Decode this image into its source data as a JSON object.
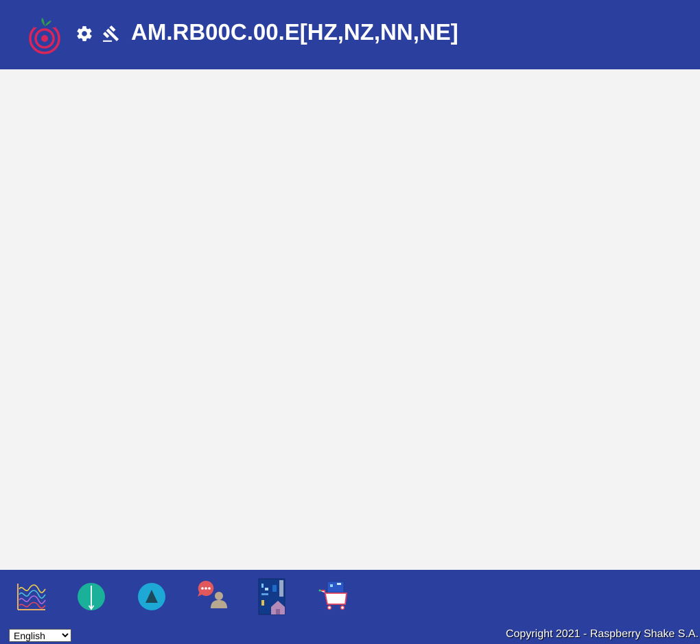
{
  "header": {
    "title": "AM.RB00C.00.E[HZ,NZ,NN,NE]",
    "logo_icon": "raspberry-shake-logo-icon",
    "settings_icon": "gear-icon",
    "gavel_icon": "gavel-icon"
  },
  "footer": {
    "dock": [
      {
        "name": "helicorder-waves-icon"
      },
      {
        "name": "down-arrow-circle-icon"
      },
      {
        "name": "triangle-circle-icon"
      },
      {
        "name": "chat-user-icon"
      },
      {
        "name": "board-home-icon"
      },
      {
        "name": "shop-cart-icon"
      }
    ],
    "language": {
      "selected": "English",
      "options": [
        "English"
      ]
    },
    "copyright": "Copyright 2021 - Raspberry Shake S.A."
  },
  "colors": {
    "brand_blue": "#2b3f9e",
    "background": "#f3f3f3",
    "logo_red": "#d7265a",
    "leaf_green": "#2e9e4c"
  }
}
